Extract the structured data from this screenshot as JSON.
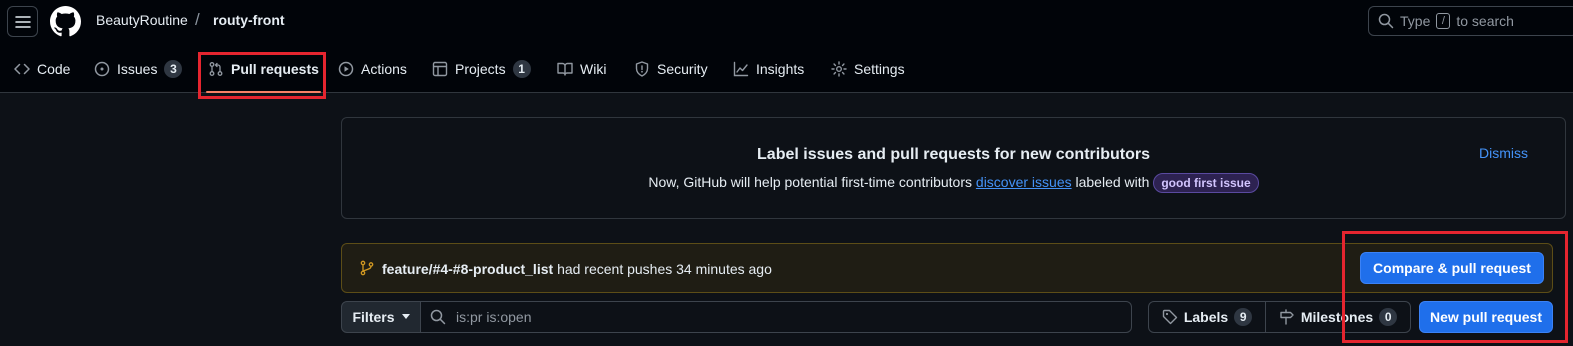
{
  "header": {
    "owner": "BeautyRoutine",
    "separator": "/",
    "repo": "routy-front",
    "search": {
      "prefix": "Type",
      "key": "/",
      "suffix": "to search"
    }
  },
  "tabs": [
    {
      "label": "Code",
      "icon": "code-icon"
    },
    {
      "label": "Issues",
      "icon": "issue-opened-icon",
      "count": "3"
    },
    {
      "label": "Pull requests",
      "icon": "git-pull-request-icon",
      "active": true
    },
    {
      "label": "Actions",
      "icon": "play-icon"
    },
    {
      "label": "Projects",
      "icon": "table-icon",
      "count": "1"
    },
    {
      "label": "Wiki",
      "icon": "book-icon"
    },
    {
      "label": "Security",
      "icon": "shield-icon"
    },
    {
      "label": "Insights",
      "icon": "graph-icon"
    },
    {
      "label": "Settings",
      "icon": "gear-icon"
    }
  ],
  "banner": {
    "title": "Label issues and pull requests for new contributors",
    "text_before": "Now, GitHub will help potential first-time contributors",
    "link": "discover issues",
    "text_after": "labeled with",
    "chip": "good first issue",
    "dismiss": "Dismiss"
  },
  "push_notice": {
    "branch": "feature/#4-#8-product_list",
    "text": "had recent pushes 34 minutes ago",
    "button": "Compare & pull request"
  },
  "filter_bar": {
    "filters_label": "Filters",
    "query": "is:pr is:open",
    "labels_label": "Labels",
    "labels_count": "9",
    "milestones_label": "Milestones",
    "milestones_count": "0",
    "new_pr_label": "New pull request"
  },
  "colors": {
    "accent_tab_underline": "#f78166",
    "primary_button": "#1f6feb",
    "link": "#4493f8",
    "highlight_box": "#e5252f"
  }
}
